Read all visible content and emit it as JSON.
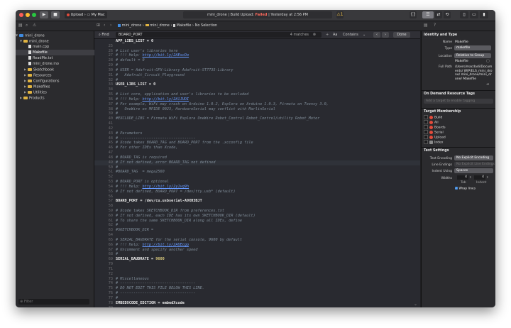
{
  "toolbar": {
    "scheme_target": "Upload",
    "scheme_device": "My Mac",
    "status_project": "mini_drone",
    "status_action": "Build Upload:",
    "status_result": "Failed",
    "status_time": "Yesterday at 2:56 PM",
    "status_warning_count": "1"
  },
  "jumpbar": {
    "crumbs": [
      "mini_drone",
      "mini_drone",
      "Makefile",
      "No Selection"
    ]
  },
  "navigator": {
    "items": [
      {
        "label": "mini_drone",
        "kind": "project"
      },
      {
        "label": "mini_drone",
        "kind": "folder"
      },
      {
        "label": "main.cpp",
        "kind": "file"
      },
      {
        "label": "Makefile",
        "kind": "file"
      },
      {
        "label": "ReadMe.txt",
        "kind": "file"
      },
      {
        "label": "mini_drone.ino",
        "kind": "file"
      },
      {
        "label": "Sketchbook",
        "kind": "folder"
      },
      {
        "label": "Resources",
        "kind": "folder"
      },
      {
        "label": "Configurations",
        "kind": "folder"
      },
      {
        "label": "Makefiles",
        "kind": "folder"
      },
      {
        "label": "Utilities",
        "kind": "folder"
      },
      {
        "label": "Products",
        "kind": "folder"
      }
    ],
    "filter_placeholder": "Filter"
  },
  "find": {
    "label": "Find",
    "query": "BOARD_PORT",
    "matches": "4 matches",
    "aa": "Aa",
    "mode": "Contains",
    "done": "Done"
  },
  "code": {
    "lines": [
      {
        "n": "",
        "t": "APP_LIBS_LIST = 0",
        "s": "d"
      },
      {
        "n": "25",
        "t": "",
        "s": ""
      },
      {
        "n": "26",
        "t": "# List user's libraries here",
        "s": "c"
      },
      {
        "n": "27",
        "t": "# !!! Help: http://bit.ly/2AEscDo",
        "s": "cu"
      },
      {
        "n": "28",
        "t": "# default = 0",
        "s": "c"
      },
      {
        "n": "29",
        "t": "#",
        "s": "c"
      },
      {
        "n": "30",
        "t": "# USER = Adafruit-GFX-Library Adafruit-ST7735-Library",
        "s": "c"
      },
      {
        "n": "31",
        "t": "#   Adafruit_Circuit_Playground",
        "s": "c"
      },
      {
        "n": "32",
        "t": "#",
        "s": "c"
      },
      {
        "n": "33",
        "t": "USER_LIBS_LIST = 0",
        "s": "d"
      },
      {
        "n": "34",
        "t": "",
        "s": ""
      },
      {
        "n": "35",
        "t": "# List core, application and user's libraries to be excluded",
        "s": "c"
      },
      {
        "n": "36",
        "t": "# !!! Help: http://bit.ly/2AlJUDI",
        "s": "cu"
      },
      {
        "n": "37",
        "t": "# For example, WiFi may crash on Arduino 1.0.2, Esplora on Arduino 1.0.3, Firmata on Teensy 3.0,",
        "s": "c"
      },
      {
        "n": "38",
        "t": "#   OneWire on MPIDE 0023, HardwareSerial may conflict with MarlinSerial",
        "s": "c"
      },
      {
        "n": "39",
        "t": "#",
        "s": "c"
      },
      {
        "n": "40",
        "t": "#EXCLUDE_LIBS = Firmata WiFi Esplora OneWire Robot_Control Robot_Control/utility Robot_Motor",
        "s": "c"
      },
      {
        "n": "41",
        "t": "",
        "s": ""
      },
      {
        "n": "42",
        "t": "",
        "s": ""
      },
      {
        "n": "43",
        "t": "# Parameters",
        "s": "c"
      },
      {
        "n": "44",
        "t": "# ----------------------------------",
        "s": "c"
      },
      {
        "n": "45",
        "t": "# Xcode takes BOARD_TAG and BOARD_PORT from the .xcconfig file",
        "s": "c"
      },
      {
        "n": "46",
        "t": "# For other IDEs than Xcode,",
        "s": "c"
      },
      {
        "n": "47",
        "t": "",
        "s": ""
      },
      {
        "n": "48",
        "t": "# BOARD_TAG is required",
        "s": "c"
      },
      {
        "n": "49",
        "t": "# If not defined, error BOARD_TAG not defined",
        "s": "c",
        "hl": true
      },
      {
        "n": "50",
        "t": "#",
        "s": "c"
      },
      {
        "n": "51",
        "t": "#BOARD_TAG  = mega2560",
        "s": "c"
      },
      {
        "n": "52",
        "t": "",
        "s": ""
      },
      {
        "n": "53",
        "t": "# BOARD_PORT is optional",
        "s": "c"
      },
      {
        "n": "54",
        "t": "# !!! Help: http://bit.ly/2y1vq9h",
        "s": "cu"
      },
      {
        "n": "55",
        "t": "# If not defined, BOARD_PORT = /dev/tty.usb* (default)",
        "s": "c"
      },
      {
        "n": "56",
        "t": "",
        "s": ""
      },
      {
        "n": "57",
        "t": "BOARD_PORT = /dev/cu.usbserial-A9XH3BJT",
        "s": "d"
      },
      {
        "n": "58",
        "t": "",
        "s": ""
      },
      {
        "n": "59",
        "t": "# Xcode takes SKETCHBOOK_DIR from preferences.txt",
        "s": "c"
      },
      {
        "n": "60",
        "t": "# If not defined, each IDE has its own SKETCHBOOK_DIR (default)",
        "s": "c"
      },
      {
        "n": "61",
        "t": "# To share the same SKETCHBOOK_DIR along all IDEs, define",
        "s": "c"
      },
      {
        "n": "62",
        "t": "#",
        "s": "c"
      },
      {
        "n": "63",
        "t": "#SKETCHBOOK_DIR =",
        "s": "c"
      },
      {
        "n": "64",
        "t": "",
        "s": ""
      },
      {
        "n": "65",
        "t": "# SERIAL_BAUDRATE for the serial console, 9600 by default",
        "s": "c"
      },
      {
        "n": "66",
        "t": "# !!! Help: http://bit.ly/2AUEcgp",
        "s": "cu"
      },
      {
        "n": "67",
        "t": "# Uncomment and specify another speed",
        "s": "c"
      },
      {
        "n": "68",
        "t": "#",
        "s": "c"
      },
      {
        "n": "69",
        "t": "SERIAL_BAUDRATE = 9600",
        "s": "dn"
      },
      {
        "n": "70",
        "t": "",
        "s": ""
      },
      {
        "n": "71",
        "t": "",
        "s": ""
      },
      {
        "n": "72",
        "t": "",
        "s": ""
      },
      {
        "n": "73",
        "t": "# Miscellaneous",
        "s": "c"
      },
      {
        "n": "74",
        "t": "# ----------------------------------",
        "s": "c"
      },
      {
        "n": "75",
        "t": "# DO NOT EDIT THIS FILE BELOW THIS LINE.",
        "s": "c"
      },
      {
        "n": "76",
        "t": "# ----------------------------------",
        "s": "c"
      },
      {
        "n": "77",
        "t": "#",
        "s": "c"
      },
      {
        "n": "78",
        "t": "EMBEDXCODE_EDITION = embedXcode",
        "s": "d"
      },
      {
        "n": "79",
        "t": "",
        "s": ""
      }
    ]
  },
  "inspector": {
    "identity_title": "Identity and Type",
    "name_label": "Name",
    "name_value": "Makefile",
    "type_label": "Type",
    "type_value": "makefile",
    "location_label": "Location",
    "location_value": "Relative to Group",
    "location_file": "Makefile",
    "fullpath_label": "Full Path",
    "fullpath_value": "/Users/macdadi/Documents/ WIP/ELS_mini_drone/ mini_drone/mini_drone/ Makefile",
    "ondemand_title": "On Demand Resource Tags",
    "ondemand_placeholder": "Add a target to enable tagging",
    "membership_title": "Target Membership",
    "targets": [
      "Build",
      "All",
      "Boards",
      "Serial",
      "Upload",
      "Index"
    ],
    "text_settings_title": "Text Settings",
    "encoding_label": "Text Encoding",
    "encoding_value": "No Explicit Encoding",
    "line_endings_label": "Line Endings",
    "line_endings_value": "No Explicit Line Endings",
    "indent_label": "Indent Using",
    "indent_value": "Spaces",
    "widths_label": "Widths",
    "tab_width": "4",
    "indent_width": "4",
    "tab_label": "Tab",
    "indent_sub_label": "Indent",
    "wrap_label": "Wrap lines"
  },
  "colors": {
    "close": "#fd5f57",
    "minimize": "#febb2e",
    "zoom": "#28c840",
    "accent": "#3f8be0",
    "error": "#e24b3b"
  }
}
